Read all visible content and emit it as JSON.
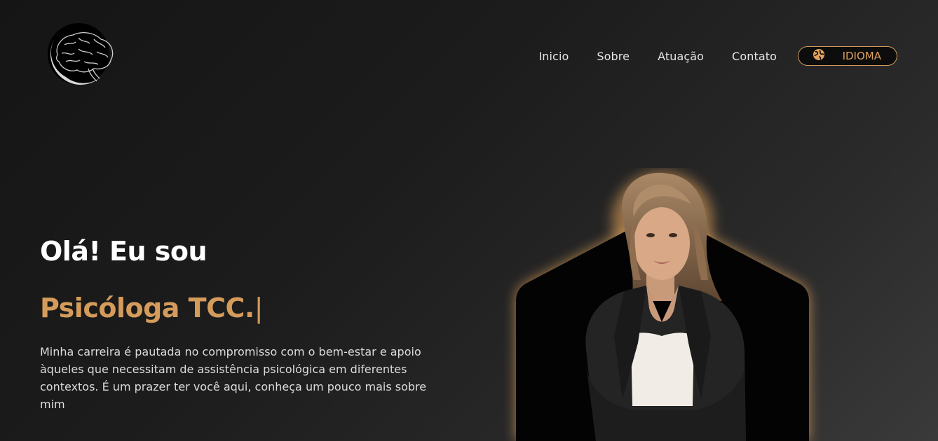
{
  "header": {
    "logo_icon": "brain-logo-icon",
    "nav": [
      {
        "label": "Inicio"
      },
      {
        "label": "Sobre"
      },
      {
        "label": "Atuação"
      },
      {
        "label": "Contato"
      }
    ],
    "language_button": {
      "label": "IDIOMA",
      "icon": "globe-icon"
    }
  },
  "hero": {
    "title": "Olá! Eu sou",
    "subtitle": "Psicóloga TCC.",
    "cursor": "|",
    "description": "Minha carreira é pautada no compromisso com o bem-estar e apoio àqueles que necessitam de assistência psicológica em diferentes contextos. É um prazer ter você aqui, conheça um pouco mais sobre mim"
  },
  "colors": {
    "accent": "#d49b5b",
    "background": "#1c1c1c",
    "text": "#ffffff"
  }
}
